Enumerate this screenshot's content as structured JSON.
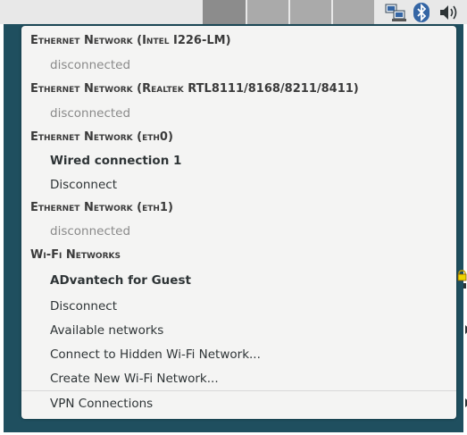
{
  "topbar": {
    "tray": {
      "network_icon": "network-wired-icon",
      "bluetooth_icon": "bluetooth-icon",
      "volume_icon": "volume-icon"
    }
  },
  "menu": {
    "sections": [
      {
        "header": "Ethernet Network (Intel I226-LM)",
        "status": "disconnected"
      },
      {
        "header": "Ethernet Network (Realtek RTL8111/8168/8211/8411)",
        "status": "disconnected"
      },
      {
        "header": "Ethernet Network (eth0)",
        "connection": "Wired connection 1",
        "action": "Disconnect"
      },
      {
        "header": "Ethernet Network (eth1)",
        "status": "disconnected"
      }
    ],
    "wifi": {
      "header": "Wi-Fi Networks",
      "connection": "ADvantech for Guest",
      "signal_icon": "wifi-signal-secure-icon",
      "action": "Disconnect",
      "available": "Available networks",
      "hidden": "Connect to Hidden Wi-Fi Network...",
      "create": "Create New Wi-Fi Network..."
    },
    "vpn": "VPN Connections"
  },
  "colors": {
    "menu_bg": "#f4f4f3",
    "frame": "#1f4f5f",
    "text": "#2e3436",
    "muted": "#8a8a8a",
    "bluetooth": "#3465a4"
  }
}
